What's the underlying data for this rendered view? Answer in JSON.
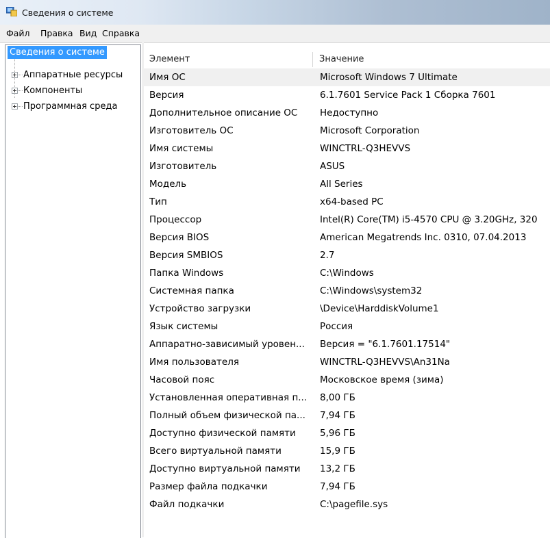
{
  "window": {
    "title": "Сведения о системе"
  },
  "menu": [
    "Файл",
    "Правка",
    "Вид",
    "Справка"
  ],
  "tree": {
    "root": "Сведения о системе",
    "items": [
      "Аппаратные ресурсы",
      "Компоненты",
      "Программная среда"
    ]
  },
  "table": {
    "headers": [
      "Элемент",
      "Значение"
    ],
    "rows": [
      [
        "Имя ОС",
        "Microsoft Windows 7 Ultimate"
      ],
      [
        "Версия",
        "6.1.7601 Service Pack 1 Сборка 7601"
      ],
      [
        "Дополнительное описание ОС",
        "Недоступно"
      ],
      [
        "Изготовитель ОС",
        "Microsoft Corporation"
      ],
      [
        "Имя системы",
        "WINCTRL-Q3HEVVS"
      ],
      [
        "Изготовитель",
        "ASUS"
      ],
      [
        "Модель",
        "All Series"
      ],
      [
        "Тип",
        "x64-based PC"
      ],
      [
        "Процессор",
        "Intel(R) Core(TM) i5-4570 CPU @ 3.20GHz, 320"
      ],
      [
        "Версия BIOS",
        "American Megatrends Inc. 0310, 07.04.2013"
      ],
      [
        "Версия SMBIOS",
        "2.7"
      ],
      [
        "Папка Windows",
        "C:\\Windows"
      ],
      [
        "Системная папка",
        "C:\\Windows\\system32"
      ],
      [
        "Устройство загрузки",
        "\\Device\\HarddiskVolume1"
      ],
      [
        "Язык системы",
        "Россия"
      ],
      [
        "Аппаратно-зависимый уровен...",
        "Версия = \"6.1.7601.17514\""
      ],
      [
        "Имя пользователя",
        "WINCTRL-Q3HEVVS\\An31Na"
      ],
      [
        "Часовой пояс",
        "Московское время (зима)"
      ],
      [
        "Установленная оперативная п...",
        "8,00 ГБ"
      ],
      [
        "Полный объем физической па...",
        "7,94 ГБ"
      ],
      [
        "Доступно физической памяти",
        "5,96 ГБ"
      ],
      [
        "Всего виртуальной памяти",
        "15,9 ГБ"
      ],
      [
        "Доступно виртуальной памяти",
        "13,2 ГБ"
      ],
      [
        "Размер файла подкачки",
        "7,94 ГБ"
      ],
      [
        "Файл подкачки",
        "C:\\pagefile.sys"
      ]
    ]
  }
}
